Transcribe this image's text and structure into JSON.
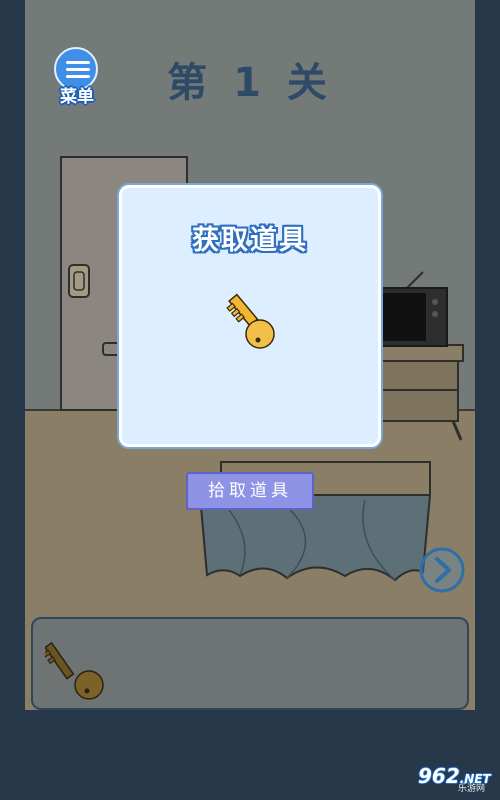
{
  "menu": {
    "label": "菜单",
    "icon": "menu-icon"
  },
  "level": {
    "title": "第 1 关"
  },
  "modal": {
    "title": "获取道具",
    "item_icon": "key-icon"
  },
  "pickup": {
    "label": "拾取道具"
  },
  "navigation": {
    "next_icon": "chevron-right-icon"
  },
  "inventory": {
    "items": [
      {
        "icon": "key-icon"
      }
    ]
  },
  "watermark": {
    "brand": "962",
    "suffix": ".NET",
    "sub": "乐游网"
  },
  "colors": {
    "accent": "#3f8ee8",
    "button": "#8e93e6",
    "key": "#f2b632",
    "background": "#26384a"
  }
}
